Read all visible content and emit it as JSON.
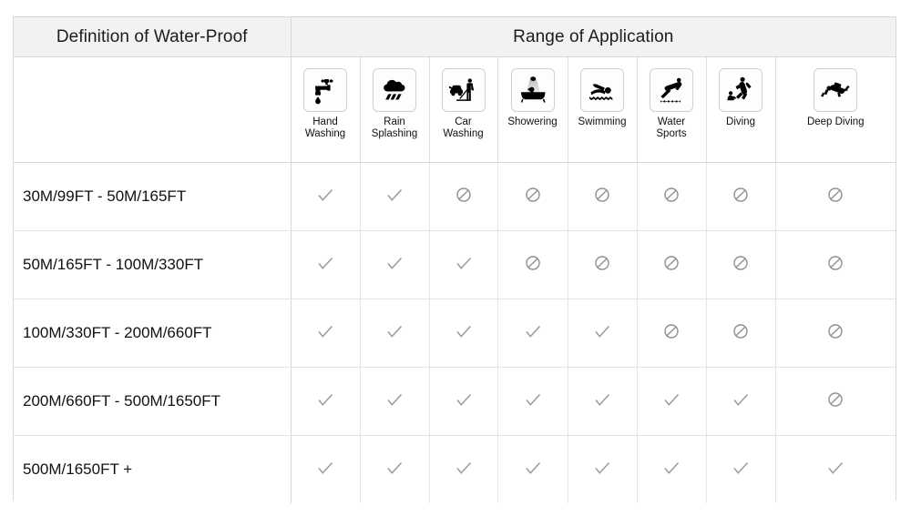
{
  "table": {
    "header_left": "Definition of Water-Proof",
    "header_right": "Range of Application",
    "columns": [
      {
        "id": "hand-washing",
        "label": "Hand\nWashing",
        "icon": "faucet-icon"
      },
      {
        "id": "rain-splashing",
        "label": "Rain\nSplashing",
        "icon": "rain-cloud-icon"
      },
      {
        "id": "car-washing",
        "label": "Car\nWashing",
        "icon": "car-washing-icon"
      },
      {
        "id": "showering",
        "label": "Showering",
        "icon": "shower-icon"
      },
      {
        "id": "swimming",
        "label": "Swimming",
        "icon": "swimmer-icon"
      },
      {
        "id": "water-sports",
        "label": "Water\nSports",
        "icon": "water-sports-icon"
      },
      {
        "id": "diving",
        "label": "Diving",
        "icon": "diving-icon"
      },
      {
        "id": "deep-diving",
        "label": "Deep Diving",
        "icon": "deep-diving-icon"
      }
    ],
    "rows": [
      {
        "label": "30M/99FT  -  50M/165FT",
        "marks": [
          "check",
          "check",
          "no",
          "no",
          "no",
          "no",
          "no",
          "no"
        ]
      },
      {
        "label": "50M/165FT  -  100M/330FT",
        "marks": [
          "check",
          "check",
          "check",
          "no",
          "no",
          "no",
          "no",
          "no"
        ]
      },
      {
        "label": "100M/330FT  -  200M/660FT",
        "marks": [
          "check",
          "check",
          "check",
          "check",
          "check",
          "no",
          "no",
          "no"
        ]
      },
      {
        "label": "200M/660FT  -  500M/1650FT",
        "marks": [
          "check",
          "check",
          "check",
          "check",
          "check",
          "check",
          "check",
          "no"
        ]
      },
      {
        "label": "500M/1650FT  +",
        "marks": [
          "check",
          "check",
          "check",
          "check",
          "check",
          "check",
          "check",
          "check"
        ]
      }
    ],
    "legend": {
      "check_name": "check-mark-icon",
      "no_name": "prohibited-icon"
    },
    "colors": {
      "band_background": "#f2f2f2",
      "border": "#d7d7d7",
      "grid": "#e2e2e2",
      "text": "#111111",
      "mark": "#9a9a9a",
      "icon": "#000000"
    }
  }
}
